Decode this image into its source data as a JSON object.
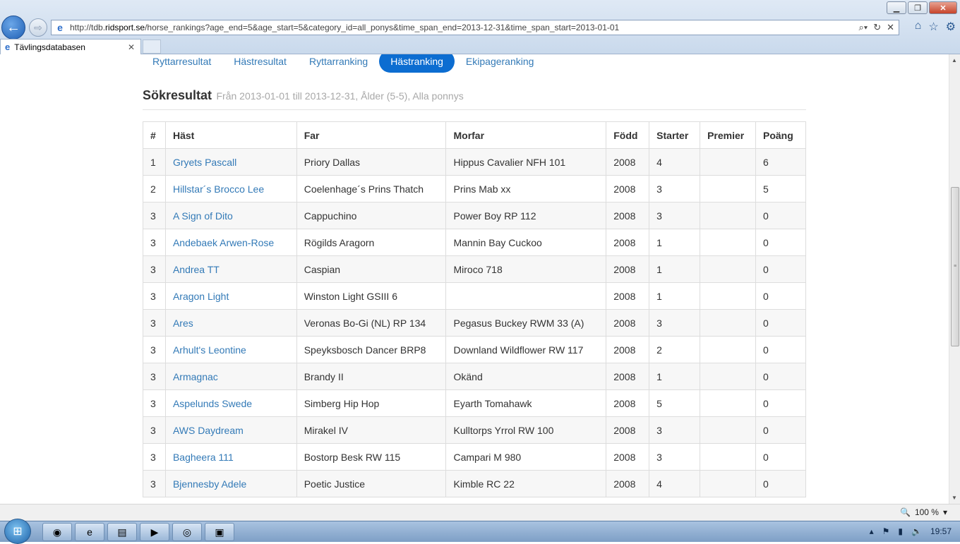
{
  "browser": {
    "url_prefix": "http://tdb.",
    "url_domain": "ridsport.se",
    "url_rest": "/horse_rankings?age_end=5&age_start=5&category_id=all_ponys&time_span_end=2013-12-31&time_span_start=2013-01-01",
    "tab_title": "Tävlingsdatabasen",
    "zoom": "100 %"
  },
  "nav_tabs": [
    "Ryttarresultat",
    "Hästresultat",
    "Ryttarranking",
    "Hästranking",
    "Ekipageranking"
  ],
  "active_tab": "Hästranking",
  "heading": {
    "title": "Sökresultat",
    "subtitle": "Från 2013-01-01 till 2013-12-31, Ålder (5-5), Alla ponnys"
  },
  "table": {
    "headers": [
      "#",
      "Häst",
      "Far",
      "Morfar",
      "Född",
      "Starter",
      "Premier",
      "Poäng"
    ],
    "rows": [
      {
        "rank": "1",
        "horse": "Gryets Pascall",
        "sire": "Priory Dallas",
        "dam_sire": "Hippus Cavalier NFH 101",
        "born": "2008",
        "starts": "4",
        "prizes": "",
        "points": "6"
      },
      {
        "rank": "2",
        "horse": "Hillstar´s Brocco Lee",
        "sire": "Coelenhage´s Prins Thatch",
        "dam_sire": "Prins Mab xx",
        "born": "2008",
        "starts": "3",
        "prizes": "",
        "points": "5"
      },
      {
        "rank": "3",
        "horse": "A Sign of Dito",
        "sire": "Cappuchino",
        "dam_sire": "Power Boy RP 112",
        "born": "2008",
        "starts": "3",
        "prizes": "",
        "points": "0"
      },
      {
        "rank": "3",
        "horse": "Andebaek Arwen-Rose",
        "sire": "Rögilds Aragorn",
        "dam_sire": "Mannin Bay Cuckoo",
        "born": "2008",
        "starts": "1",
        "prizes": "",
        "points": "0"
      },
      {
        "rank": "3",
        "horse": "Andrea TT",
        "sire": "Caspian",
        "dam_sire": "Miroco 718",
        "born": "2008",
        "starts": "1",
        "prizes": "",
        "points": "0"
      },
      {
        "rank": "3",
        "horse": "Aragon Light",
        "sire": "Winston Light GSIII 6",
        "dam_sire": "",
        "born": "2008",
        "starts": "1",
        "prizes": "",
        "points": "0"
      },
      {
        "rank": "3",
        "horse": "Ares",
        "sire": "Veronas Bo-Gi (NL) RP 134",
        "dam_sire": "Pegasus Buckey RWM 33 (A)",
        "born": "2008",
        "starts": "3",
        "prizes": "",
        "points": "0"
      },
      {
        "rank": "3",
        "horse": "Arhult's Leontine",
        "sire": "Speyksbosch Dancer BRP8",
        "dam_sire": "Downland Wildflower RW 117",
        "born": "2008",
        "starts": "2",
        "prizes": "",
        "points": "0"
      },
      {
        "rank": "3",
        "horse": "Armagnac",
        "sire": "Brandy II",
        "dam_sire": "Okänd",
        "born": "2008",
        "starts": "1",
        "prizes": "",
        "points": "0"
      },
      {
        "rank": "3",
        "horse": "Aspelunds Swede",
        "sire": "Simberg Hip Hop",
        "dam_sire": "Eyarth Tomahawk",
        "born": "2008",
        "starts": "5",
        "prizes": "",
        "points": "0"
      },
      {
        "rank": "3",
        "horse": "AWS Daydream",
        "sire": "Mirakel IV",
        "dam_sire": "Kulltorps Yrrol RW 100",
        "born": "2008",
        "starts": "3",
        "prizes": "",
        "points": "0"
      },
      {
        "rank": "3",
        "horse": "Bagheera 111",
        "sire": "Bostorp Besk RW 115",
        "dam_sire": "Campari M 980",
        "born": "2008",
        "starts": "3",
        "prizes": "",
        "points": "0"
      },
      {
        "rank": "3",
        "horse": "Bjennesby Adele",
        "sire": "Poetic Justice",
        "dam_sire": "Kimble RC 22",
        "born": "2008",
        "starts": "4",
        "prizes": "",
        "points": "0"
      }
    ]
  },
  "taskbar": {
    "clock": "19:57"
  },
  "icons": {
    "back": "back-arrow-icon",
    "forward": "forward-arrow-icon",
    "search": "search-icon",
    "refresh": "refresh-icon",
    "stop": "close-icon",
    "home": "home-icon",
    "favorites": "star-icon",
    "settings": "gear-icon"
  }
}
